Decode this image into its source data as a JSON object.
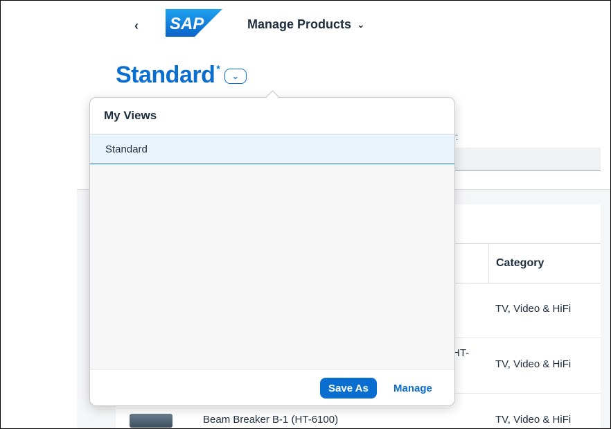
{
  "shell": {
    "back_icon": "chevron-left-icon",
    "logo_text": "SAP",
    "app_title": "Manage Products",
    "app_title_icon": "chevron-down-icon"
  },
  "variant": {
    "name": "Standard",
    "modified_marker": "*",
    "toggle_icon": "chevron-down-icon"
  },
  "filter": {
    "label_fragment": "r:"
  },
  "table": {
    "category_header": "Category",
    "rows": [
      {
        "product": "",
        "category": "TV, Video & HiFi"
      },
      {
        "product": "HT-",
        "category": "TV, Video & HiFi"
      },
      {
        "product": "Beam Breaker B-1 (HT-6100)",
        "category": "TV, Video & HiFi"
      }
    ]
  },
  "popover": {
    "title": "My Views",
    "items": [
      {
        "label": "Standard",
        "selected": true
      }
    ],
    "save_as_label": "Save As",
    "manage_label": "Manage"
  },
  "colors": {
    "accent": "#0a6ed1",
    "text": "#1d2d3e",
    "selected_bg": "#eaf4fd"
  }
}
